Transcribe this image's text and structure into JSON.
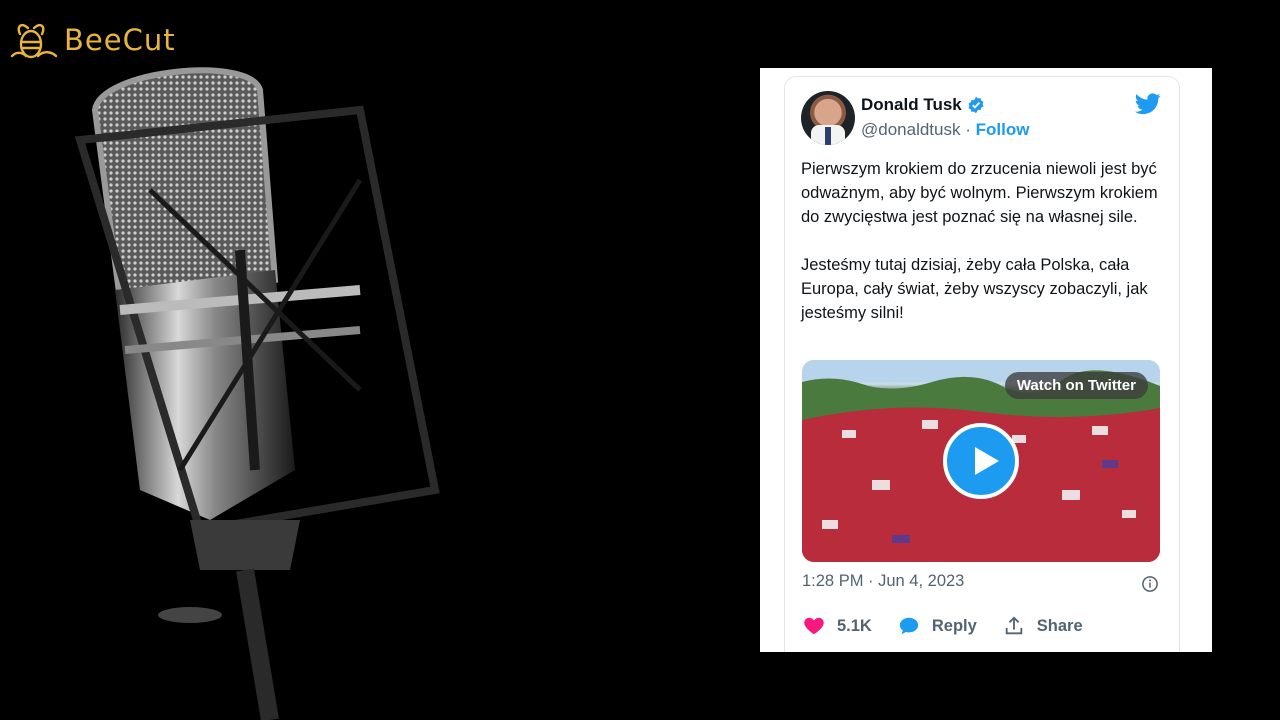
{
  "watermark": {
    "brand": "BeeCut",
    "color": "#e8b43c"
  },
  "tweet": {
    "author_name": "Donald Tusk",
    "handle": "@donaldtusk",
    "separator": " · ",
    "follow_label": "Follow",
    "verified_icon": "verified-badge-icon",
    "logo_icon": "twitter-bird-icon",
    "body": "Pierwszym krokiem do zrzucenia niewoli jest być odważnym, aby być wolnym. Pierwszym krokiem do zwycięstwa jest poznać się na własnej sile.\n\nJesteśmy tutaj dzisiaj, żeby cała Polska, cała Europa, cały świat, żeby wszyscy zobaczyli, jak jesteśmy silni!",
    "media_button": "Watch on Twitter",
    "timestamp": "1:28 PM · Jun 4, 2023",
    "likes": "5.1K",
    "reply_label": "Reply",
    "share_label": "Share",
    "accent_color": "#1d9bf0",
    "like_color": "#f91880"
  }
}
